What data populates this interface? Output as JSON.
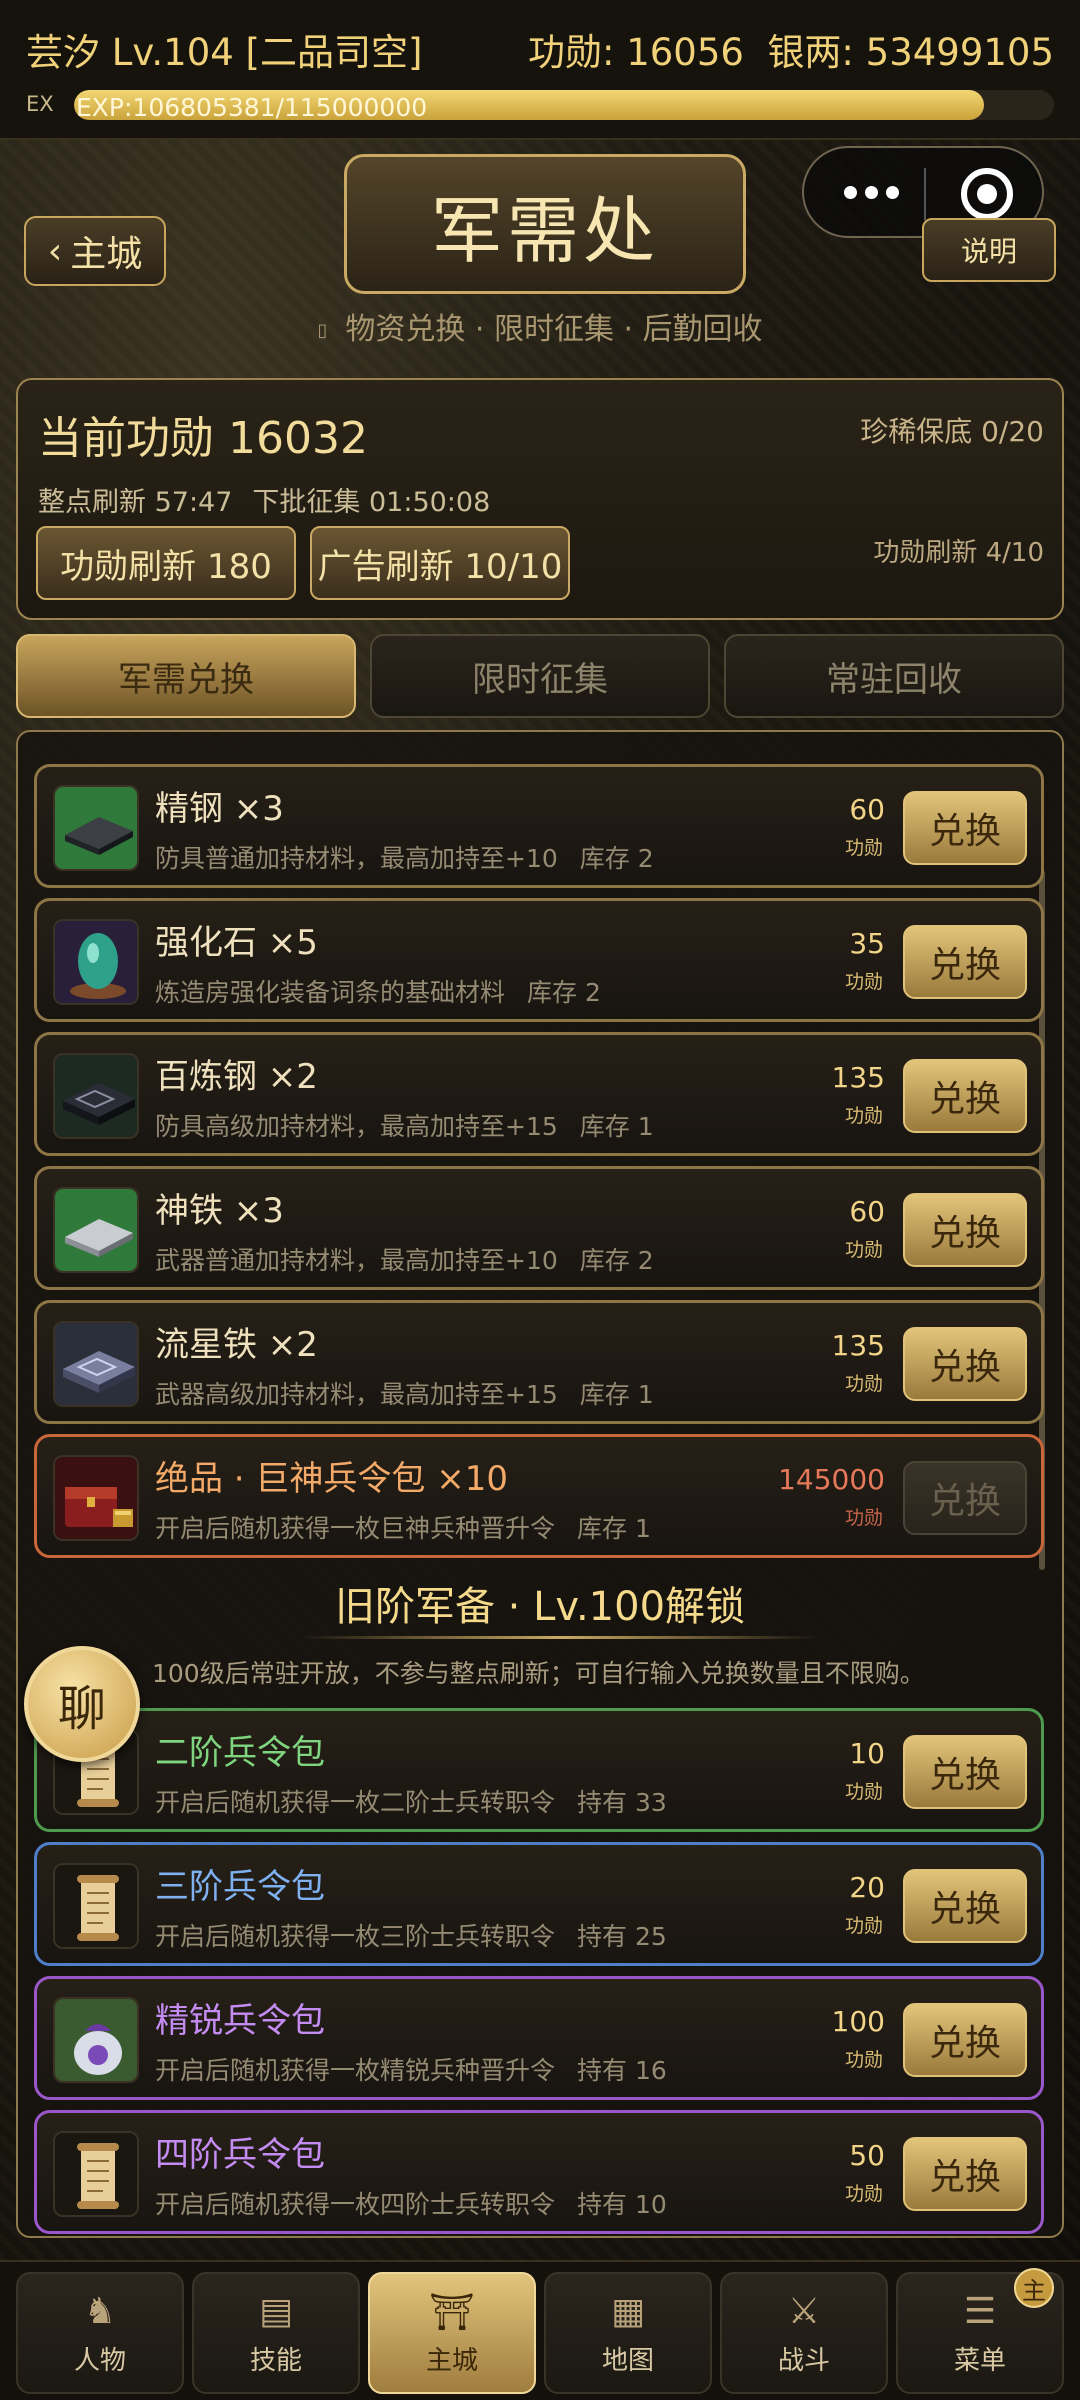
{
  "status": {
    "player": "芸汐 Lv.104 [二品司空]",
    "merit": "功勋: 16056",
    "silver": "银两: 53499105",
    "exp_label": "EX",
    "exp_text": "EXP:106805381/115000000",
    "exp_progress": 0.9287
  },
  "header": {
    "back_label": "主城",
    "title": "军需处",
    "help_label": "说明",
    "subtitle": "物资兑换 · 限时征集 · 后勤回收"
  },
  "panel": {
    "current_merit": "当前功勋 16032",
    "rare_guarantee": "珍稀保底 0/20",
    "refresh_timer": "整点刷新 57:47",
    "next_batch": "下批征集 01:50:08",
    "merit_refresh_btn": "功勋刷新 180",
    "ad_refresh_btn": "广告刷新 10/10",
    "refresh_count": "功勋刷新 4/10"
  },
  "tabs": [
    {
      "label": "军需兑换",
      "active": true
    },
    {
      "label": "限时征集",
      "active": false
    },
    {
      "label": "常驻回收",
      "active": false
    }
  ],
  "exchange_label": "兑换",
  "cost_unit": "功勋",
  "items": [
    {
      "name": "精钢 ×3",
      "desc": "防具普通加持材料，最高加持至+10",
      "stock": "库存 2",
      "cost": "60",
      "icon": "steel-plate-icon"
    },
    {
      "name": "强化石 ×5",
      "desc": "炼造房强化装备词条的基础材料",
      "stock": "库存 2",
      "cost": "35",
      "icon": "jade-stone-icon"
    },
    {
      "name": "百炼钢 ×2",
      "desc": "防具高级加持材料，最高加持至+15",
      "stock": "库存 1",
      "cost": "135",
      "icon": "dark-steel-icon"
    },
    {
      "name": "神铁 ×3",
      "desc": "武器普通加持材料，最高加持至+10",
      "stock": "库存 2",
      "cost": "60",
      "icon": "divine-iron-icon"
    },
    {
      "name": "流星铁 ×2",
      "desc": "武器高级加持材料，最高加持至+15",
      "stock": "库存 1",
      "cost": "135",
      "icon": "meteor-iron-icon"
    },
    {
      "name": "绝品 · 巨神兵令包 ×10",
      "desc": "开启后随机获得一枚巨神兵种晋升令",
      "stock": "库存 1",
      "cost": "145000",
      "icon": "treasure-chest-icon"
    }
  ],
  "legacy": {
    "title": "旧阶军备 · Lv.100解锁",
    "note": "100级后常驻开放，不参与整点刷新；可自行输入兑换数量且不限购。",
    "items": [
      {
        "name": "二阶兵令包",
        "desc": "开启后随机获得一枚二阶士兵转职令",
        "held": "持有 33",
        "cost": "10",
        "icon": "scroll-icon"
      },
      {
        "name": "三阶兵令包",
        "desc": "开启后随机获得一枚三阶士兵转职令",
        "held": "持有 25",
        "cost": "20",
        "icon": "scroll-icon"
      },
      {
        "name": "精锐兵令包",
        "desc": "开启后随机获得一枚精锐兵种晋升令",
        "held": "持有 16",
        "cost": "100",
        "icon": "elite-pouch-icon"
      },
      {
        "name": "四阶兵令包",
        "desc": "开启后随机获得一枚四阶士兵转职令",
        "held": "持有 10",
        "cost": "50",
        "icon": "scroll-icon"
      }
    ]
  },
  "chat_label": "聊",
  "nav": [
    {
      "label": "人物",
      "icon": "warrior-icon"
    },
    {
      "label": "技能",
      "icon": "scroll-map-icon"
    },
    {
      "label": "主城",
      "icon": "pagoda-icon"
    },
    {
      "label": "地图",
      "icon": "map-icon"
    },
    {
      "label": "战斗",
      "icon": "crossed-swords-icon"
    },
    {
      "label": "菜单",
      "icon": "menu-scroll-icon"
    }
  ],
  "menu_badge": "主"
}
